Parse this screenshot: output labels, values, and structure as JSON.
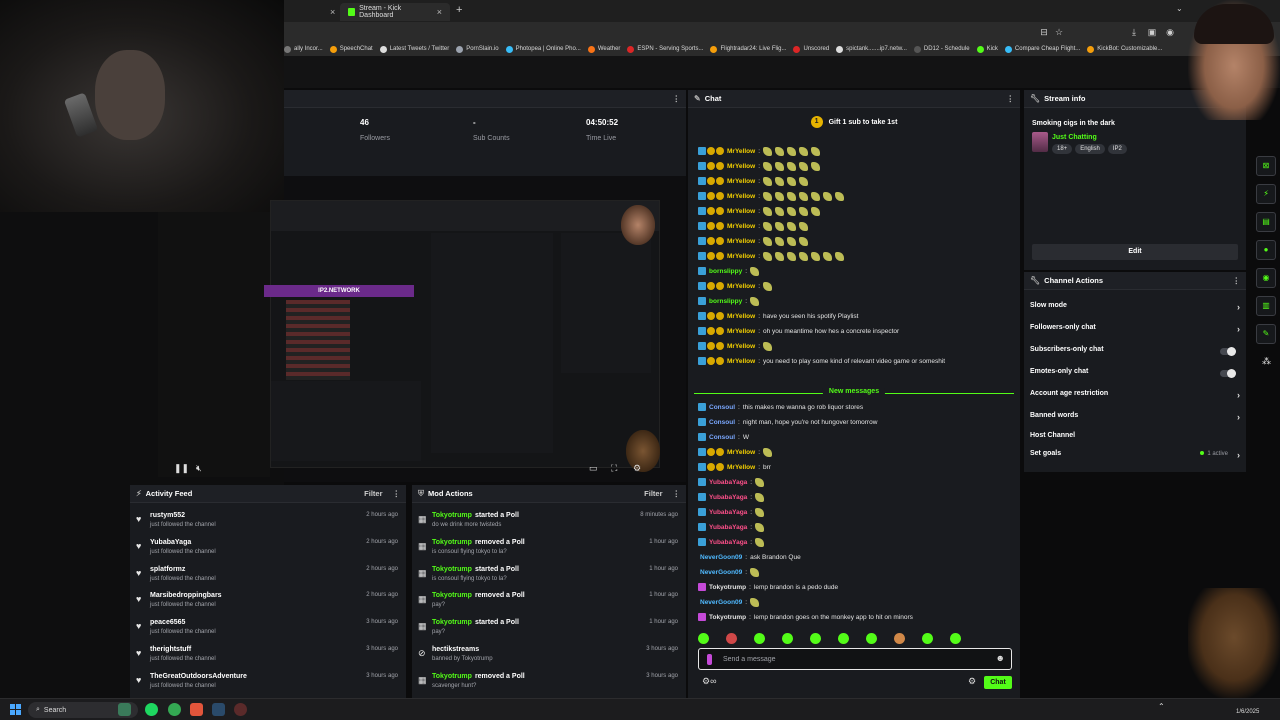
{
  "browser": {
    "tabs": [
      {
        "label": "",
        "active": false
      },
      {
        "label": "Stream - Kick Dashboard",
        "active": true
      }
    ],
    "bookmarks": [
      {
        "label": "ally Incor...",
        "color": "#777777"
      },
      {
        "label": "SpeechChat",
        "color": "#f59e0b"
      },
      {
        "label": "Latest Tweets / Twitter",
        "color": "#dddddd"
      },
      {
        "label": "PornSlain.io",
        "color": "#9ca3af"
      },
      {
        "label": "Photopea | Online Pho...",
        "color": "#38bdf8"
      },
      {
        "label": "Weather",
        "color": "#f97316"
      },
      {
        "label": "ESPN - Serving Sports...",
        "color": "#dc2626"
      },
      {
        "label": "Flightradar24: Live Flig...",
        "color": "#f59e0b"
      },
      {
        "label": "Unscored",
        "color": "#dc2626"
      },
      {
        "label": "spictank.......ip7.netw...",
        "color": "#dddddd"
      },
      {
        "label": "DD12 - Schedule",
        "color": "#555555"
      },
      {
        "label": "Kick",
        "color": "#53fc18"
      },
      {
        "label": "Compare Cheap Flight...",
        "color": "#38bdf8"
      },
      {
        "label": "KickBot: Customizable...",
        "color": "#f59e0b"
      }
    ]
  },
  "stats": [
    {
      "value": "46",
      "label": "Followers"
    },
    {
      "value": "-",
      "label": "Sub Counts"
    },
    {
      "value": "04:50:52",
      "label": "Time Live"
    }
  ],
  "preview": {
    "banner": "IP2.NETWORK"
  },
  "activity": {
    "title": "Activity Feed",
    "filter": "Filter",
    "items": [
      {
        "name": "rustym552",
        "sub": "just followed the channel",
        "time": "2 hours ago"
      },
      {
        "name": "YubabaYaga",
        "sub": "just followed the channel",
        "time": "2 hours ago"
      },
      {
        "name": "splatformz",
        "sub": "just followed the channel",
        "time": "2 hours ago"
      },
      {
        "name": "Marsibedroppingbars",
        "sub": "just followed the channel",
        "time": "2 hours ago"
      },
      {
        "name": "peace6565",
        "sub": "just followed the channel",
        "time": "3 hours ago"
      },
      {
        "name": "therightstuff",
        "sub": "just followed the channel",
        "time": "3 hours ago"
      },
      {
        "name": "TheGreatOutdoorsAdventure",
        "sub": "just followed the channel",
        "time": "3 hours ago"
      }
    ]
  },
  "mod": {
    "title": "Mod Actions",
    "filter": "Filter",
    "items": [
      {
        "user": "Tokyotrump",
        "action": "started a Poll",
        "sub": "do we drink more twisteds",
        "time": "8 minutes ago"
      },
      {
        "user": "Tokyotrump",
        "action": "removed a Poll",
        "sub": "is consoul flying tokyo to la?",
        "time": "1 hour ago"
      },
      {
        "user": "Tokyotrump",
        "action": "started a Poll",
        "sub": "is consoul flying tokyo to la?",
        "time": "1 hour ago"
      },
      {
        "user": "Tokyotrump",
        "action": "removed a Poll",
        "sub": "pay?",
        "time": "1 hour ago"
      },
      {
        "user": "Tokyotrump",
        "action": "started a Poll",
        "sub": "pay?",
        "time": "1 hour ago"
      },
      {
        "user": "hectikstreams",
        "action": "",
        "sub": "banned by Tokyotrump",
        "time": "3 hours ago"
      },
      {
        "user": "Tokyotrump",
        "action": "removed a Poll",
        "sub": "scavenger hunt?",
        "time": "3 hours ago"
      }
    ]
  },
  "chat": {
    "title": "Chat",
    "gift": "Gift 1 sub to take 1st",
    "new_messages": "New messages",
    "placeholder": "Send a message",
    "send_label": "Chat",
    "messages": [
      {
        "user": "MrYellow",
        "cls": "u-y",
        "badges": 3,
        "text": "",
        "emotes": 5
      },
      {
        "user": "MrYellow",
        "cls": "u-y",
        "badges": 3,
        "text": "",
        "emotes": 5
      },
      {
        "user": "MrYellow",
        "cls": "u-y",
        "badges": 3,
        "text": "",
        "emotes": 4
      },
      {
        "user": "MrYellow",
        "cls": "u-y",
        "badges": 3,
        "text": "",
        "emotes": 7
      },
      {
        "user": "MrYellow",
        "cls": "u-y",
        "badges": 3,
        "text": "",
        "emotes": 5
      },
      {
        "user": "MrYellow",
        "cls": "u-y",
        "badges": 3,
        "text": "",
        "emotes": 4
      },
      {
        "user": "MrYellow",
        "cls": "u-y",
        "badges": 3,
        "text": "",
        "emotes": 4
      },
      {
        "user": "MrYellow",
        "cls": "u-y",
        "badges": 3,
        "text": "",
        "emotes": 7
      },
      {
        "user": "bornslippy",
        "cls": "u-g",
        "badges": 1,
        "text": "",
        "emotes": 1
      },
      {
        "user": "MrYellow",
        "cls": "u-y",
        "badges": 3,
        "text": "",
        "emotes": 1
      },
      {
        "user": "bornslippy",
        "cls": "u-g",
        "badges": 1,
        "text": "",
        "emotes": 1
      },
      {
        "user": "MrYellow",
        "cls": "u-y",
        "badges": 3,
        "text": "have you seen his spotify Playlist",
        "emotes": 0
      },
      {
        "user": "MrYellow",
        "cls": "u-y",
        "badges": 3,
        "text": "oh you meantime how hes a concrete inspector",
        "emotes": 0
      },
      {
        "user": "MrYellow",
        "cls": "u-y",
        "badges": 3,
        "text": "",
        "emotes": 1
      },
      {
        "user": "MrYellow",
        "cls": "u-y",
        "badges": 3,
        "text": "you need to play some kind of relevant video game or someshit",
        "emotes": 0
      },
      {
        "user": "Consoul",
        "cls": "u-b",
        "badges": 1,
        "text": "this makes me wanna go rob liquor stores",
        "emotes": 0
      },
      {
        "user": "Consoul",
        "cls": "u-b",
        "badges": 1,
        "text": "night man, hope you're not hungover tomorrow",
        "emotes": 0
      },
      {
        "user": "Consoul",
        "cls": "u-b",
        "badges": 1,
        "text": "W",
        "emotes": 0
      },
      {
        "user": "MrYellow",
        "cls": "u-y",
        "badges": 3,
        "text": "",
        "emotes": 1
      },
      {
        "user": "MrYellow",
        "cls": "u-y",
        "badges": 3,
        "text": "brr",
        "emotes": 0
      },
      {
        "user": "YubabaYaga",
        "cls": "u-p",
        "badges": 1,
        "text": "",
        "emotes": 1
      },
      {
        "user": "YubabaYaga",
        "cls": "u-p",
        "badges": 1,
        "text": "",
        "emotes": 1
      },
      {
        "user": "YubabaYaga",
        "cls": "u-p",
        "badges": 1,
        "text": "",
        "emotes": 1
      },
      {
        "user": "YubabaYaga",
        "cls": "u-p",
        "badges": 1,
        "text": "",
        "emotes": 1
      },
      {
        "user": "YubabaYaga",
        "cls": "u-p",
        "badges": 1,
        "text": "",
        "emotes": 1
      },
      {
        "user": "NeverGoon09",
        "cls": "u-c",
        "badges": 0,
        "text": "ask Brandon Que",
        "emotes": 0
      },
      {
        "user": "NeverGoon09",
        "cls": "u-c",
        "badges": 0,
        "text": "",
        "emotes": 1
      },
      {
        "user": "Tokyotrump",
        "cls": "",
        "badges": 1,
        "text": "lemp brandon is a pedo dude",
        "emotes": 0
      },
      {
        "user": "NeverGoon09",
        "cls": "u-c",
        "badges": 0,
        "text": "",
        "emotes": 1
      },
      {
        "user": "Tokyotrump",
        "cls": "",
        "badges": 1,
        "text": "lemp brandon goes on the monkey app to hit on minors",
        "emotes": 0
      }
    ]
  },
  "stream_info": {
    "title": "Stream info",
    "stream_title": "Smoking cigs in the dark",
    "category": "Just Chatting",
    "tags": [
      "18+",
      "English",
      "IP2"
    ],
    "edit_label": "Edit"
  },
  "channel_actions": {
    "title": "Channel Actions",
    "items": [
      {
        "label": "Slow mode",
        "kind": "chevron"
      },
      {
        "label": "Followers-only chat",
        "kind": "chevron"
      },
      {
        "label": "Subscribers-only chat",
        "kind": "toggle"
      },
      {
        "label": "Emotes-only chat",
        "kind": "toggle"
      },
      {
        "label": "Account age restriction",
        "kind": "chevron"
      },
      {
        "label": "Banned words",
        "kind": "chevron"
      },
      {
        "label": "Host Channel",
        "kind": "none"
      },
      {
        "label": "Set goals",
        "kind": "chevron",
        "extra": "1 active"
      }
    ]
  },
  "taskbar": {
    "search": "Search",
    "date": "1/6/2025"
  },
  "colors": {
    "accent": "#53fc18",
    "panel": "#191b1f",
    "bg": "#0b0b0c"
  }
}
